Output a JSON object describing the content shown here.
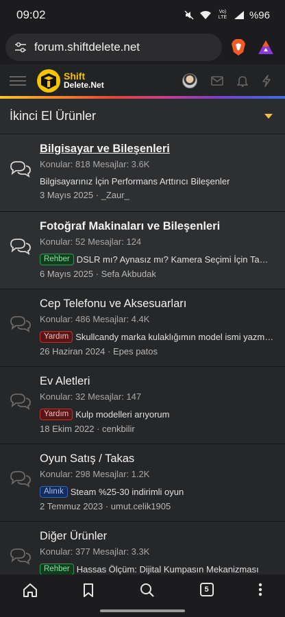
{
  "status_bar": {
    "time": "09:02",
    "battery": "%96",
    "volte": "Vo) LTE",
    "icons": [
      "mute-icon",
      "wifi-icon",
      "signal-icon",
      "battery-icon"
    ]
  },
  "browser": {
    "url": "forum.shiftdelete.net",
    "icons": [
      "site-settings-icon",
      "brave-shield-icon",
      "brave-rewards-icon"
    ]
  },
  "site_header": {
    "logo_line1": "Shift",
    "logo_line2": "Delete.Net",
    "icons": [
      "menu-icon",
      "avatar",
      "mail-icon",
      "bell-icon",
      "lightning-icon"
    ]
  },
  "section": {
    "title": "İkinci El Ürünler"
  },
  "forums": [
    {
      "title": "Bilgisayar ve Bileşenleri",
      "stats": "Konular: 818 Mesajlar: 3.6K",
      "prefix": "",
      "latest": "Bilgisayarınız İçin Performans Arttırıcı Bileşenler",
      "meta": "3 Mayıs 2025 · _Zaur_"
    },
    {
      "title": "Fotoğraf Makinaları ve Bileşenleri",
      "stats": "Konular: 52 Mesajlar: 124",
      "prefix": "Rehber",
      "latest": "DSLR mı? Aynasız mı? Kamera Seçimi İçin Tam Rehber",
      "meta": "6 Mayıs 2025 · Sefa Akbudak"
    },
    {
      "title": "Cep Telefonu ve Aksesuarları",
      "stats": "Konular: 486 Mesajlar: 4.4K",
      "prefix": "Yardım",
      "latest": "Skullcandy marka kulaklığımın model ismi yazmıyor",
      "meta": "26 Haziran 2024 · Epes patos"
    },
    {
      "title": "Ev Aletleri",
      "stats": "Konular: 32 Mesajlar: 147",
      "prefix": "Yardım",
      "latest": "Kulp modelleri arıyorum",
      "meta": "18 Ekim 2022 · cenkbilir"
    },
    {
      "title": "Oyun Satış / Takas",
      "stats": "Konular: 298 Mesajlar: 1.2K",
      "prefix": "Alınık",
      "latest": "Steam %25-30 indirimli oyun",
      "meta": "2 Temmuz 2023 · umut.celik1905"
    },
    {
      "title": "Diğer Ürünler",
      "stats": "Konular: 377 Mesajlar: 3.3K",
      "prefix": "Rehber",
      "latest": "Hassas Ölçüm: Dijital Kumpasın Mekanizması",
      "meta": ""
    }
  ],
  "bottom_nav": {
    "tab_count": "5",
    "icons": [
      "home-icon",
      "bookmark-icon",
      "search-icon",
      "tabs-icon",
      "more-icon"
    ]
  },
  "colors": {
    "accent": "#f2c14e",
    "prefix_green": "#2d9c52",
    "prefix_red": "#b33333",
    "prefix_blue": "#3a62c2"
  }
}
